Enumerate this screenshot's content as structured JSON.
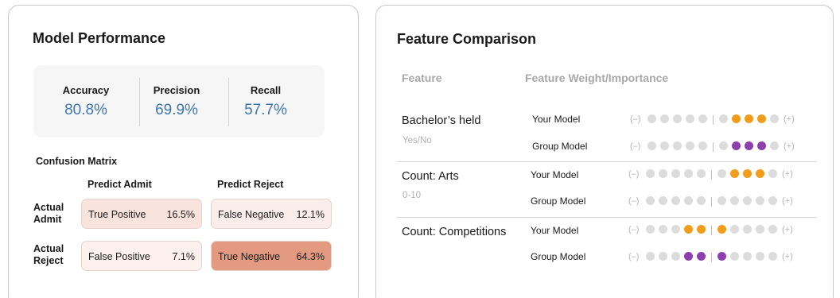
{
  "model_performance": {
    "title": "Model Performance",
    "metrics": [
      {
        "label": "Accuracy",
        "value": "80.8%"
      },
      {
        "label": "Precision",
        "value": "69.9%"
      },
      {
        "label": "Recall",
        "value": "57.7%"
      }
    ],
    "confusion_matrix": {
      "title": "Confusion Matrix",
      "col_headers": [
        "Predict Admit",
        "Predict Reject"
      ],
      "row_headers": [
        "Actual Admit",
        "Actual Reject"
      ],
      "cells": [
        {
          "label": "True Positive",
          "value": "16.5%",
          "color": "#f8e3dd"
        },
        {
          "label": "False Negative",
          "value": "12.1%",
          "color": "#fbeeea"
        },
        {
          "label": "False Positive",
          "value": "7.1%",
          "color": "#fcf1ee"
        },
        {
          "label": "True Negative",
          "value": "64.3%",
          "color": "#e39a80"
        }
      ]
    }
  },
  "feature_comparison": {
    "title": "Feature Comparison",
    "header_feature": "Feature",
    "header_weight": "Feature Weight/Importance",
    "scale_min": "(–)",
    "scale_max": "(+)",
    "colors": {
      "your_model": "#f29c1b",
      "group_model": "#8e3fae",
      "inactive": "#dcdcdc"
    },
    "features": [
      {
        "name": "Bachelor’s held",
        "subtitle": "Yes/No",
        "models": [
          {
            "label": "Your Model",
            "filled": [
              6,
              7,
              8
            ],
            "color": "orange"
          },
          {
            "label": "Group Model",
            "filled": [
              6,
              7,
              8
            ],
            "color": "purple"
          }
        ]
      },
      {
        "name": "Count: Arts",
        "subtitle": "0-10",
        "models": [
          {
            "label": "Your Model",
            "filled": [
              6,
              7,
              8
            ],
            "color": "orange"
          },
          {
            "label": "Group Model",
            "filled": [],
            "color": "purple"
          }
        ]
      },
      {
        "name": "Count: Competitions",
        "subtitle": "",
        "models": [
          {
            "label": "Your Model",
            "filled": [
              3,
              4,
              5
            ],
            "color": "orange"
          },
          {
            "label": "Group Model",
            "filled": [
              3,
              4,
              5
            ],
            "color": "purple"
          }
        ]
      }
    ]
  }
}
